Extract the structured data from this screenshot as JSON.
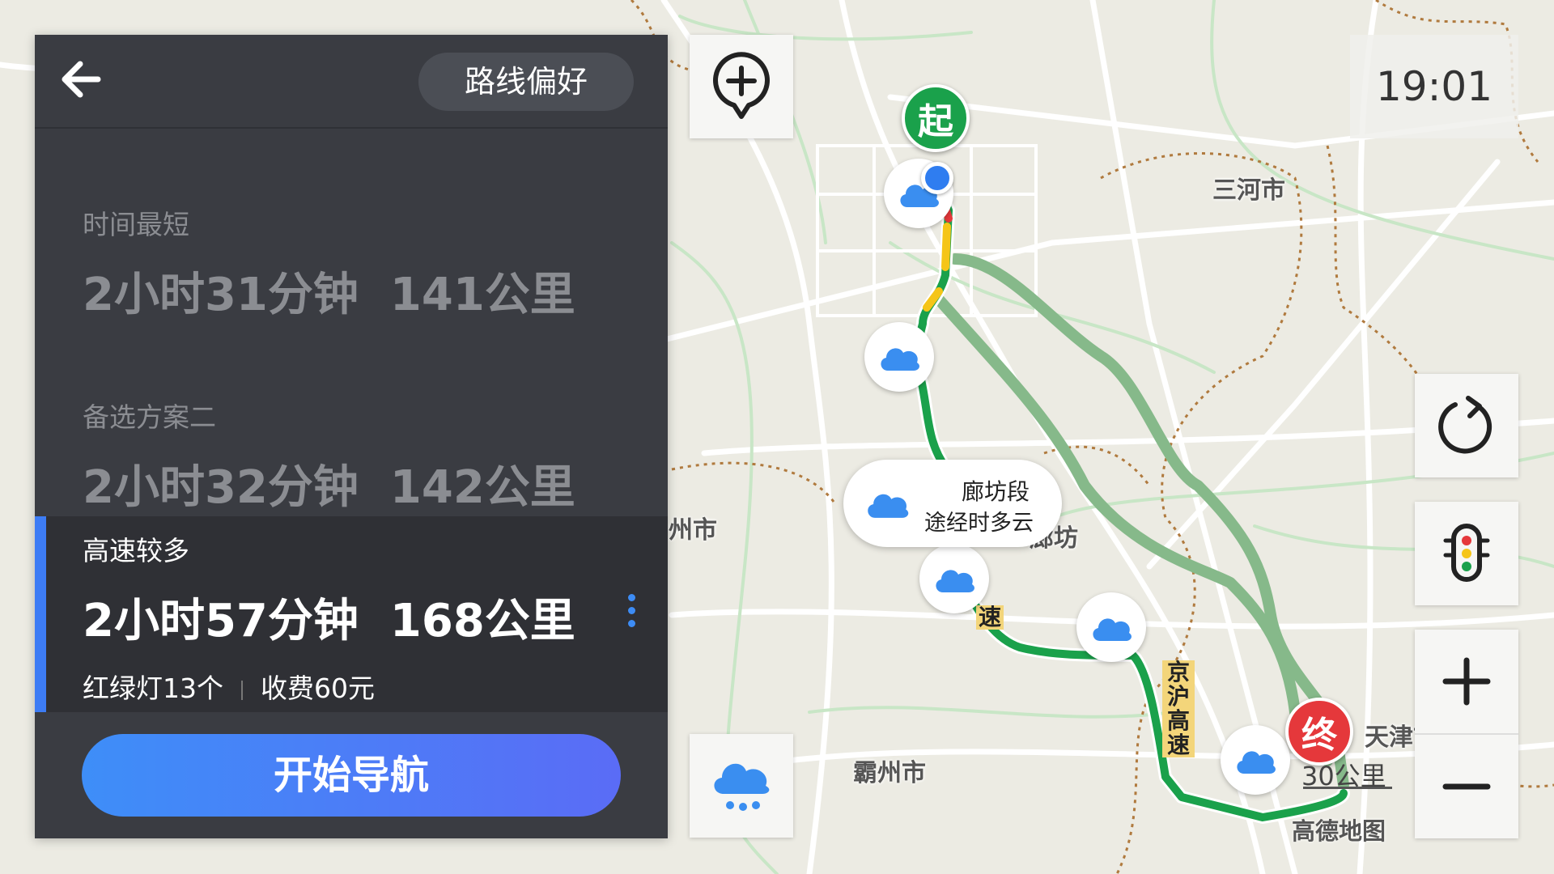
{
  "panel": {
    "preference_label": "路线偏好",
    "routes": [
      {
        "tag": "时间最短",
        "duration": "2小时31分钟",
        "distance": "141公里"
      },
      {
        "tag": "备选方案二",
        "duration": "2小时32分钟",
        "distance": "142公里"
      },
      {
        "tag": "高速较多",
        "duration": "2小时57分钟",
        "distance": "168公里",
        "traffic_lights": "红绿灯13个",
        "toll": "收费60元"
      }
    ],
    "start_label": "开始导航"
  },
  "status": {
    "time": "19:01"
  },
  "map": {
    "labels": {
      "sanhe": "三河市",
      "langfang": "廊坊",
      "bazhou": "霸州市",
      "tianjin": "天津市",
      "zhuozhou": "州市"
    },
    "start_marker": "起",
    "end_marker": "终",
    "weather_card": {
      "title": "廊坊段",
      "text": "途经时多云"
    },
    "road_labels": {
      "jinghu": "京沪高速",
      "gaosu": "速"
    },
    "scale": "30公里",
    "logo": "高德地图"
  },
  "colors": {
    "accent": "#3d7cf5",
    "panel_bg": "#3a3c42",
    "route_green": "#1aa14b",
    "alt_route": "#86b98a",
    "start_pin": "#1aa14b",
    "end_pin": "#e5383b"
  },
  "icons": {
    "back": "back-arrow-icon",
    "add_place": "add-location-icon",
    "refresh": "refresh-icon",
    "traffic": "traffic-light-icon",
    "zoom_in": "zoom-in-icon",
    "zoom_out": "zoom-out-icon",
    "weather": "weather-cloud-icon"
  }
}
